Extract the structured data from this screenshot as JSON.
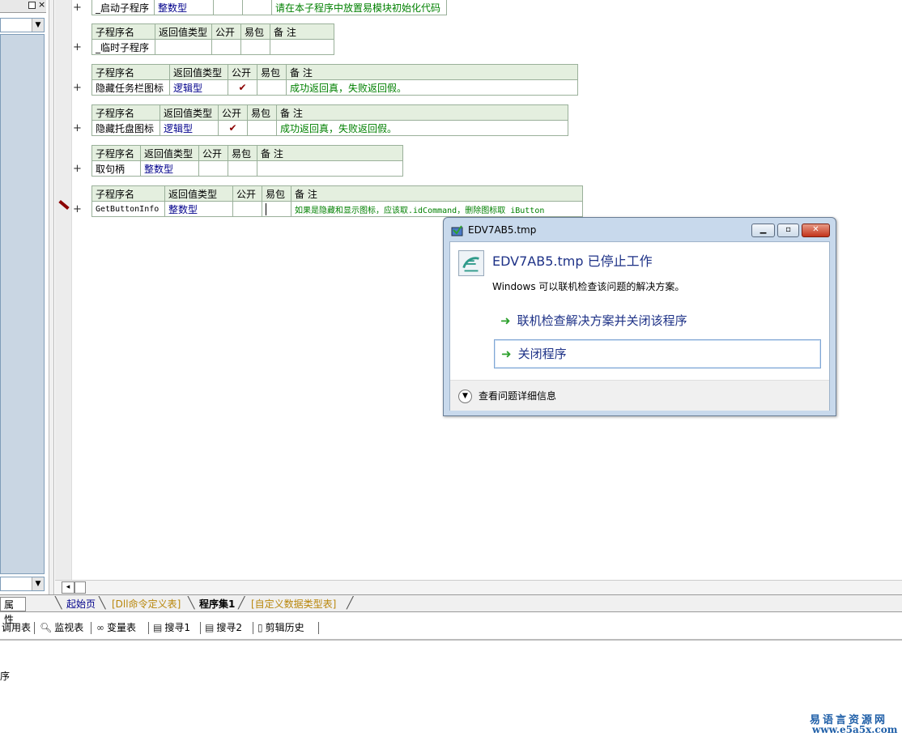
{
  "left_panel": {
    "close_glyph": "×",
    "combo_arrow": "▼"
  },
  "procedures": [
    {
      "name": "_启动子程序",
      "type": "整数型",
      "public": "",
      "pack": "",
      "note": "请在本子程序中放置易模块初始化代码"
    },
    {
      "name": "_临时子程序",
      "type": "",
      "public": "",
      "pack": "",
      "note": ""
    },
    {
      "name": "隐藏任务栏图标",
      "type": "逻辑型",
      "public": "✔",
      "pack": "",
      "note": "成功返回真，失败返回假。"
    },
    {
      "name": "隐藏托盘图标",
      "type": "逻辑型",
      "public": "✔",
      "pack": "",
      "note": "成功返回真，失败返回假。"
    },
    {
      "name": "取句柄",
      "type": "整数型",
      "public": "",
      "pack": "",
      "note": ""
    },
    {
      "name": "GetButtonInfo",
      "type": "整数型",
      "public": "",
      "pack": "",
      "note": "如果是隐藏和显示图标，应该取.idCommand，删除图标取 iButton"
    }
  ],
  "headers": {
    "name": "子程序名",
    "type": "返回值类型",
    "public": "公开",
    "pack": "易包",
    "note": "备 注"
  },
  "plus_sign": "+",
  "tabs": {
    "properties": "属性",
    "start": "起始页",
    "dll": "[Dll命令定义表]",
    "program": "程序集1",
    "datatypes": "[自定义数据类型表]"
  },
  "toolbar": {
    "call_table": "调用表",
    "watch": "监视表",
    "variables": "变量表",
    "search1": "搜寻1",
    "search2": "搜寻2",
    "clip_history": "剪辑历史"
  },
  "output_text": "序",
  "watermark": {
    "line1": "易语言资源网",
    "line2": "www.e5a5x.com"
  },
  "dialog": {
    "title": "EDV7AB5.tmp",
    "heading": "EDV7AB5.tmp 已停止工作",
    "description": "Windows 可以联机检查该问题的解决方案。",
    "option_check_online": "联机检查解决方案并关闭该程序",
    "option_close": "关闭程序",
    "details": "查看问题详细信息",
    "colors": {
      "heading": "#1e3287",
      "arrow": "#2ea12e"
    }
  }
}
